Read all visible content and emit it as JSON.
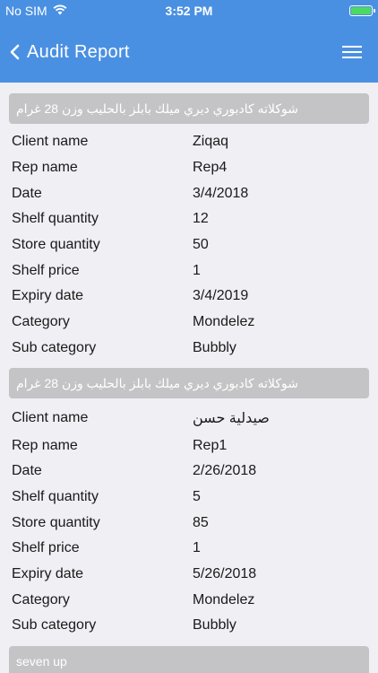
{
  "status_bar": {
    "carrier": "No SIM",
    "wifi_icon": "wifi-icon",
    "time": "3:52 PM",
    "battery_icon": "battery-icon",
    "battery_level": 1.0,
    "battery_color": "#4cd964"
  },
  "navbar": {
    "title": "Audit Report",
    "back_icon": "chevron-left-icon",
    "menu_icon": "hamburger-menu-icon",
    "color": "#4a90e2"
  },
  "labels": {
    "client": "Client name",
    "rep": "Rep name",
    "date": "Date",
    "shelf_qty": "Shelf quantity",
    "store_qty": "Store quantity",
    "shelf_price": "Shelf price",
    "expiry": "Expiry date",
    "category": "Category",
    "sub_category": "Sub category"
  },
  "reports": [
    {
      "product": "شوكلاته كادبوري ديري ميلك بابلز بالحليب وزن 28 غرام",
      "client": "Ziqaq",
      "rep": "Rep4",
      "date": "3/4/2018",
      "shelf_qty": "12",
      "store_qty": "50",
      "shelf_price": "1",
      "expiry": "3/4/2019",
      "category": "Mondelez",
      "sub_category": "Bubbly"
    },
    {
      "product": "شوكلاته كادبوري ديري ميلك بابلز بالحليب وزن 28 غرام",
      "client": "صيدلية حسن",
      "rep": "Rep1",
      "date": "2/26/2018",
      "shelf_qty": "5",
      "store_qty": "85",
      "shelf_price": "1",
      "expiry": "5/26/2018",
      "category": "Mondelez",
      "sub_category": "Bubbly"
    }
  ],
  "partial_card": {
    "product": "seven up"
  }
}
